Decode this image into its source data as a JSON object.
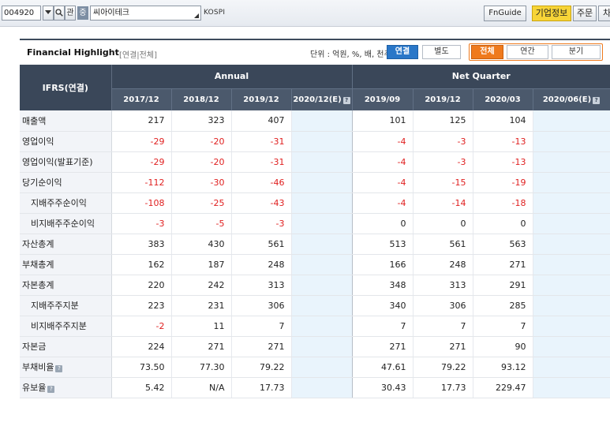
{
  "toolbar": {
    "stock_code": "004920",
    "related_label": "관",
    "market_badge": "중",
    "company_name": "씨아이테크",
    "market": "KOSPI",
    "fnguide_label": "FnGuide",
    "nav": [
      "기업정보",
      "주문",
      "차"
    ],
    "active_nav": "기업정보"
  },
  "panel": {
    "title": "Financial Highlight",
    "subtitle": "[연결|전체]",
    "unit_text": "단위 : 억원, %, 배, 천주",
    "consolidation_tabs": [
      "연결",
      "별도"
    ],
    "active_consolidation": "연결",
    "period_tabs": [
      "전체",
      "연간",
      "분기"
    ],
    "active_period": "전체"
  },
  "table": {
    "label_header": "IFRS(연결)",
    "annual_header": "Annual",
    "quarter_header": "Net Quarter",
    "annual_periods": [
      "2017/12",
      "2018/12",
      "2019/12",
      "2020/12(E)"
    ],
    "quarter_periods": [
      "2019/09",
      "2019/12",
      "2020/03",
      "2020/06(E)"
    ],
    "rows": [
      {
        "label": "매출액",
        "indent": false,
        "help": false,
        "annual": [
          "217",
          "323",
          "407",
          ""
        ],
        "quarter": [
          "101",
          "125",
          "104",
          ""
        ]
      },
      {
        "label": "영업이익",
        "indent": false,
        "help": false,
        "annual": [
          "-29",
          "-20",
          "-31",
          ""
        ],
        "quarter": [
          "-4",
          "-3",
          "-13",
          ""
        ]
      },
      {
        "label": "영업이익(발표기준)",
        "indent": false,
        "help": false,
        "annual": [
          "-29",
          "-20",
          "-31",
          ""
        ],
        "quarter": [
          "-4",
          "-3",
          "-13",
          ""
        ]
      },
      {
        "label": "당기순이익",
        "indent": false,
        "help": false,
        "annual": [
          "-112",
          "-30",
          "-46",
          ""
        ],
        "quarter": [
          "-4",
          "-15",
          "-19",
          ""
        ]
      },
      {
        "label": "지배주주순이익",
        "indent": true,
        "help": false,
        "annual": [
          "-108",
          "-25",
          "-43",
          ""
        ],
        "quarter": [
          "-4",
          "-14",
          "-18",
          ""
        ]
      },
      {
        "label": "비지배주주순이익",
        "indent": true,
        "help": false,
        "annual": [
          "-3",
          "-5",
          "-3",
          ""
        ],
        "quarter": [
          "0",
          "0",
          "0",
          ""
        ]
      },
      {
        "label": "자산총계",
        "indent": false,
        "help": false,
        "annual": [
          "383",
          "430",
          "561",
          ""
        ],
        "quarter": [
          "513",
          "561",
          "563",
          ""
        ]
      },
      {
        "label": "부채총계",
        "indent": false,
        "help": false,
        "annual": [
          "162",
          "187",
          "248",
          ""
        ],
        "quarter": [
          "166",
          "248",
          "271",
          ""
        ]
      },
      {
        "label": "자본총계",
        "indent": false,
        "help": false,
        "annual": [
          "220",
          "242",
          "313",
          ""
        ],
        "quarter": [
          "348",
          "313",
          "291",
          ""
        ]
      },
      {
        "label": "지배주주지분",
        "indent": true,
        "help": false,
        "annual": [
          "223",
          "231",
          "306",
          ""
        ],
        "quarter": [
          "340",
          "306",
          "285",
          ""
        ]
      },
      {
        "label": "비지배주주지분",
        "indent": true,
        "help": false,
        "annual": [
          "-2",
          "11",
          "7",
          ""
        ],
        "quarter": [
          "7",
          "7",
          "7",
          ""
        ]
      },
      {
        "label": "자본금",
        "indent": false,
        "help": false,
        "annual": [
          "224",
          "271",
          "271",
          ""
        ],
        "quarter": [
          "271",
          "271",
          "90",
          ""
        ]
      },
      {
        "label": "부채비율",
        "indent": false,
        "help": true,
        "annual": [
          "73.50",
          "77.30",
          "79.22",
          ""
        ],
        "quarter": [
          "47.61",
          "79.22",
          "93.12",
          ""
        ]
      },
      {
        "label": "유보율",
        "indent": false,
        "help": true,
        "annual": [
          "5.42",
          "N/A",
          "17.73",
          ""
        ],
        "quarter": [
          "30.43",
          "17.73",
          "229.47",
          ""
        ]
      }
    ]
  },
  "colors": {
    "header_bg": "#3a4759",
    "negative": "#e02020",
    "estimate_bg": "#e9f4fc",
    "active_blue": "#2a77c8",
    "active_orange": "#ef7a1d",
    "active_nav": "#f7d437"
  },
  "icons": [
    "dropdown-icon",
    "search-icon",
    "help-icon",
    "resize-grip-icon"
  ]
}
